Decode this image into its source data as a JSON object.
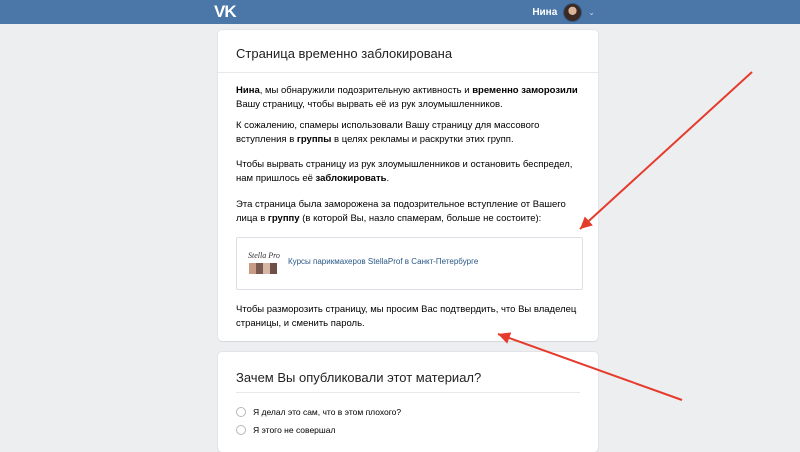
{
  "header": {
    "logo": "VK",
    "user_name": "Нина",
    "chevron": "⌄"
  },
  "blocked": {
    "title": "Страница временно заблокирована",
    "p1": {
      "name": "Нина",
      "t1": ", мы обнаружили подозрительную активность и ",
      "b1": "временно заморозили",
      "t2": " Вашу страницу, чтобы вырвать её из рук злоумышленников."
    },
    "p2": {
      "t1": "К сожалению, спамеры использовали Вашу страницу для массового вступления в ",
      "b1": "группы",
      "t2": " в целях рекламы и раскрутки этих групп."
    },
    "p3": {
      "t1": "Чтобы вырвать страницу из рук злоумышленников и остановить беспредел, нам пришлось её ",
      "b1": "заблокировать",
      "t2": "."
    },
    "p4": {
      "t1": "Эта страница была заморожена за подозрительное вступление от Вашего лица в ",
      "b1": "группу",
      "t2": " (в которой Вы, назло спамерам, больше не состоите):"
    },
    "group": {
      "image_text": "Stella Pro",
      "link": "Курсы парикмахеров StellaProf в Санкт-Петербурге"
    },
    "p5": "Чтобы разморозить страницу, мы просим Вас подтвердить, что Вы владелец страницы, и сменить пароль."
  },
  "survey": {
    "title": "Зачем Вы опубликовали этот материал?",
    "options": [
      "Я делал это сам, что в этом плохого?",
      "Я этого не совершал"
    ]
  },
  "annotation_color": "#e53b2c"
}
